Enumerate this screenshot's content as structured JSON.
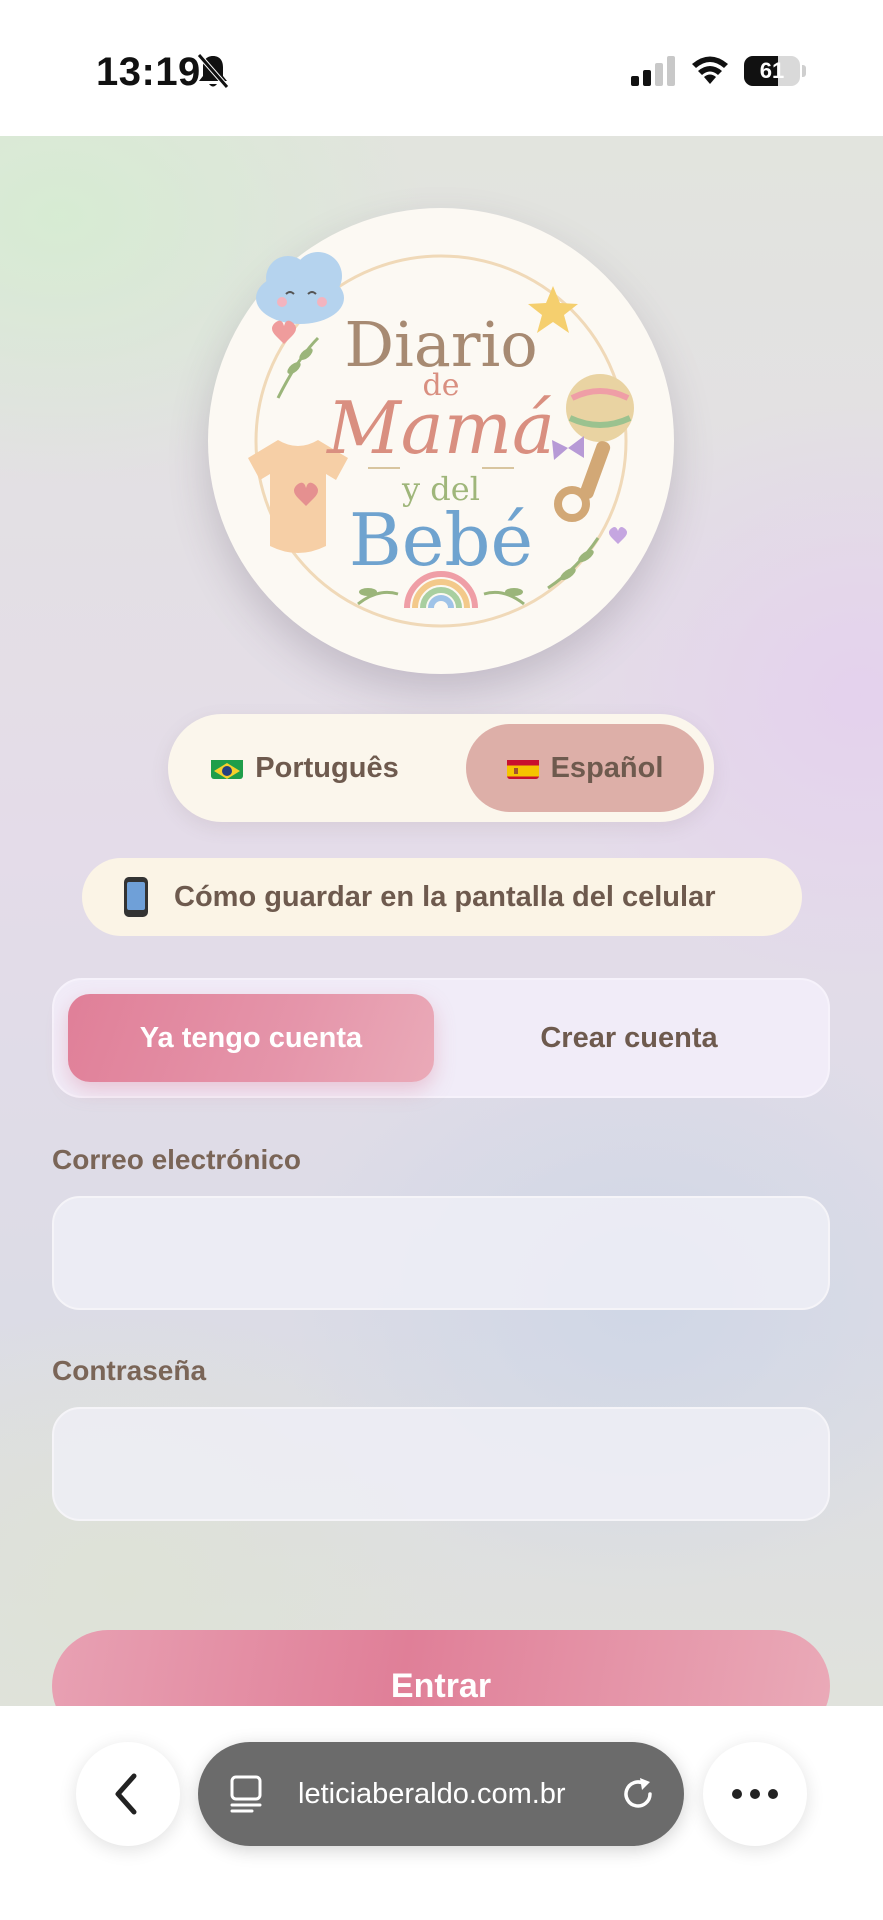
{
  "status_bar": {
    "time": "13:19",
    "battery": "61",
    "battery_fraction": 0.61
  },
  "logo": {
    "line1": "Diario",
    "line2": "de",
    "line3": "Mamá",
    "line4": "y del",
    "line5": "Bebé"
  },
  "language": {
    "options": [
      {
        "label": "Português",
        "flag": "brazil-flag-icon"
      },
      {
        "label": "Español",
        "flag": "spain-flag-icon"
      }
    ],
    "selected": "Español"
  },
  "install_banner": {
    "icon": "phone-icon",
    "label": "Cómo guardar en la pantalla del celular"
  },
  "auth_tabs": {
    "login": "Ya tengo cuenta",
    "signup": "Crear cuenta",
    "active": "login"
  },
  "form": {
    "email_label": "Correo electrónico",
    "email_value": "",
    "password_label": "Contraseña",
    "password_value": "",
    "submit_label": "Entrar"
  },
  "browser": {
    "url": "leticiaberaldo.com.br"
  },
  "colors": {
    "accent_pink": "#e07f98",
    "selected_language": "#ddafa8",
    "text_brown": "#6e5a4e"
  }
}
